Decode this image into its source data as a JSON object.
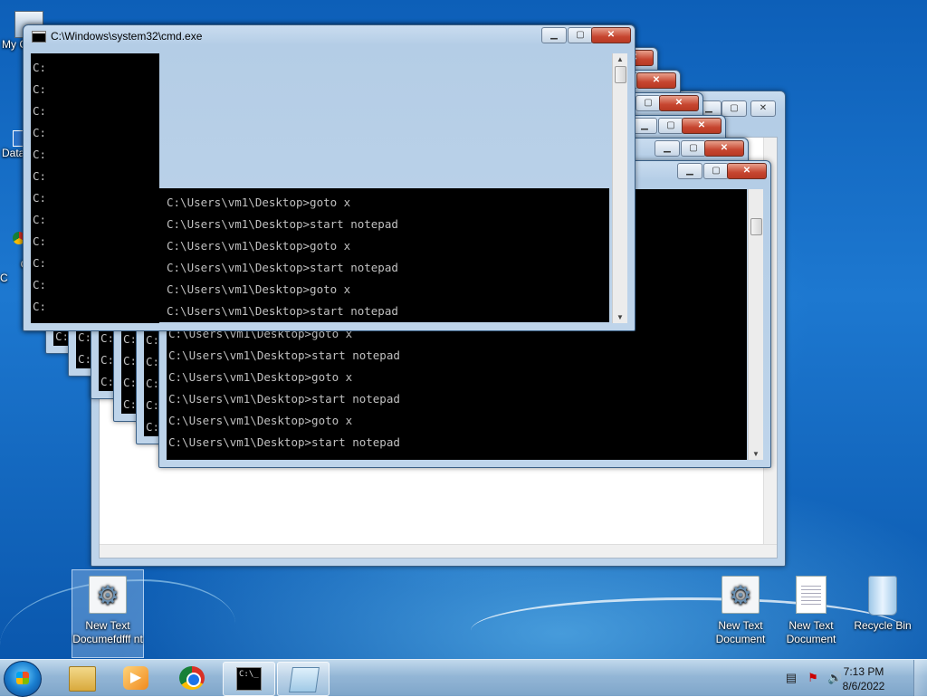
{
  "desktop": {
    "left_icons": [
      {
        "label": "My C",
        "name": "computer-icon"
      },
      {
        "label": "Data",
        "name": "data-shortcut-icon"
      },
      {
        "label": "G\nC",
        "name": "chrome-shortcut-icon"
      }
    ],
    "icons": [
      {
        "label": "New Text Documefdfff nt",
        "name": "new-text-document-selected",
        "kind": "gear"
      },
      {
        "label": "New Text Document",
        "name": "new-text-document-gear",
        "kind": "gear"
      },
      {
        "label": "New Text Document",
        "name": "new-text-document-plain",
        "kind": "doc"
      },
      {
        "label": "Recycle Bin",
        "name": "recycle-bin",
        "kind": "bin"
      }
    ]
  },
  "cmd": {
    "title": "C:\\Windows\\system32\\cmd.exe",
    "prompt_stub": "C:",
    "lines_top": [
      "C:\\Users\\vm1\\Desktop>goto x",
      "C:\\Users\\vm1\\Desktop>start notepad",
      "C:\\Users\\vm1\\Desktop>goto x",
      "C:\\Users\\vm1\\Desktop>start notepad",
      "C:\\Users\\vm1\\Desktop>goto x",
      "C:\\Users\\vm1\\Desktop>start notepad"
    ],
    "lines_bottom": [
      "C:\\Users\\vm1\\Desktop>goto x",
      "C:\\Users\\vm1\\Desktop>start notepad",
      "C:\\Users\\vm1\\Desktop>goto x",
      "C:\\Users\\vm1\\Desktop>start notepad",
      "C:\\Users\\vm1\\Desktop>goto x",
      "C:\\Users\\vm1\\Desktop>start notepad"
    ],
    "window_buttons": {
      "minimize": "▁",
      "maximize": "▢",
      "close": "✕"
    }
  },
  "taskbar": {
    "buttons": [
      {
        "name": "explorer-taskbar-button",
        "icon": "folder-icon"
      },
      {
        "name": "media-player-taskbar-button",
        "icon": "media-player-icon"
      },
      {
        "name": "chrome-taskbar-button",
        "icon": "chrome-icon"
      },
      {
        "name": "cmd-taskbar-button",
        "icon": "cmd-icon",
        "label": "C:\\_"
      },
      {
        "name": "notepad-taskbar-button",
        "icon": "notepad-icon"
      }
    ],
    "time": "7:13 PM",
    "date": "8/6/2022"
  },
  "colors": {
    "console_bg": "#000000",
    "console_text": "#c0c0c0",
    "close_red": "#c6452f"
  }
}
